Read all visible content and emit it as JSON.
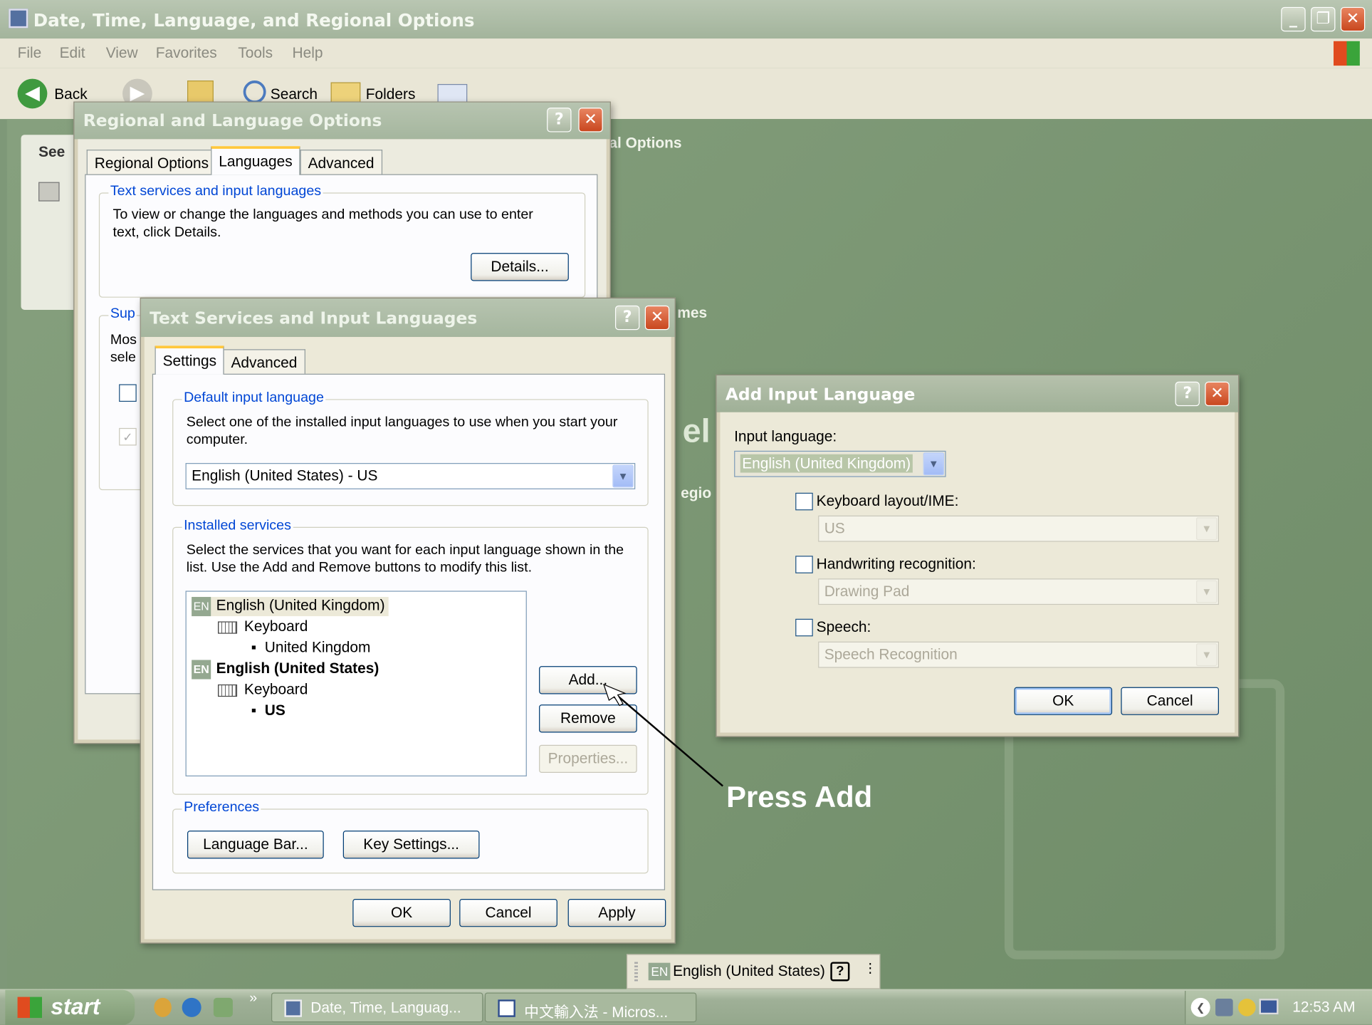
{
  "explorer": {
    "title": "Date, Time, Language, and Regional Options",
    "menu": [
      "File",
      "Edit",
      "View",
      "Favorites",
      "Tools",
      "Help"
    ],
    "toolbar": {
      "back": "Back",
      "search": "Search",
      "folders": "Folders"
    },
    "see_label": "See",
    "bg_fragments": {
      "options": "al Options",
      "mes": "mes",
      "el": "el",
      "regio": "egio"
    }
  },
  "regional": {
    "title": "Regional and Language Options",
    "tabs": [
      "Regional Options",
      "Languages",
      "Advanced"
    ],
    "group_title": "Text services and input languages",
    "desc_line1": "To view or change the languages and methods you can use to enter",
    "desc_line2": "text, click Details.",
    "details_button": "Details...",
    "sup_fragment": "Sup",
    "mos_fragment": "Mos",
    "sele_fragment": "sele"
  },
  "text_services": {
    "title": "Text Services and Input Languages",
    "tabs": [
      "Settings",
      "Advanced"
    ],
    "default_group": "Default input language",
    "default_desc_line1": "Select one of the installed input languages to use when you start your",
    "default_desc_line2": "computer.",
    "default_value": "English (United States) - US",
    "installed_group": "Installed services",
    "installed_desc_line1": "Select the services that you want for each input language shown in the",
    "installed_desc_line2": "list. Use the Add and Remove buttons to modify this list.",
    "tree": {
      "lang1": "English (United Kingdom)",
      "lang1_service": "Keyboard",
      "lang1_layout": "United Kingdom",
      "lang2": "English (United States)",
      "lang2_service": "Keyboard",
      "lang2_layout": "US",
      "badge": "EN"
    },
    "add_button": "Add...",
    "remove_button": "Remove",
    "properties_button": "Properties...",
    "preferences_group": "Preferences",
    "language_bar_button": "Language Bar...",
    "key_settings_button": "Key Settings...",
    "ok": "OK",
    "cancel": "Cancel",
    "apply": "Apply"
  },
  "add_input": {
    "title": "Add Input Language",
    "input_language_label": "Input language:",
    "input_language_value": "English (United Kingdom)",
    "keyboard_label": "Keyboard layout/IME:",
    "keyboard_value": "US",
    "handwriting_label": "Handwriting recognition:",
    "handwriting_value": "Drawing Pad",
    "speech_label": "Speech:",
    "speech_value": "Speech Recognition",
    "ok": "OK",
    "cancel": "Cancel"
  },
  "annotation": {
    "text": "Press Add"
  },
  "language_bar": {
    "badge": "EN",
    "label": "English (United States)"
  },
  "taskbar": {
    "start": "start",
    "tasks": [
      "Date, Time, Languag...",
      "中文輸入法 - Micros..."
    ],
    "clock": "12:53 AM"
  }
}
